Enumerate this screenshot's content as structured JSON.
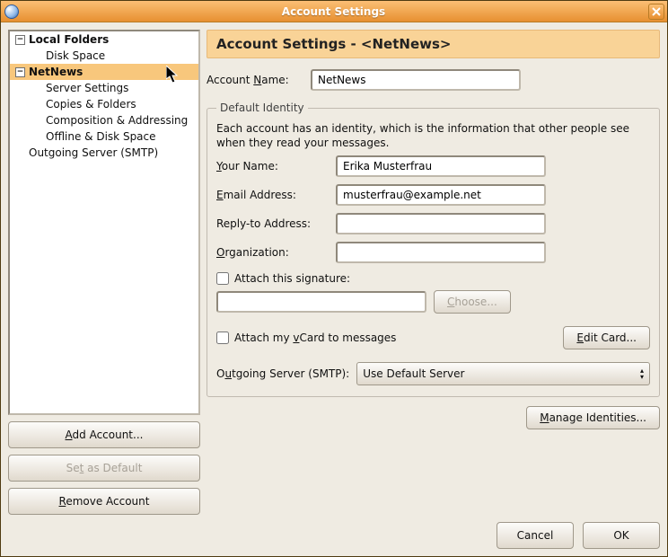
{
  "window": {
    "title": "Account Settings"
  },
  "tree": {
    "items": [
      {
        "label": "Local Folders",
        "level": 0,
        "expandable": true
      },
      {
        "label": "Disk Space",
        "level": 1
      },
      {
        "label": "NetNews",
        "level": 0,
        "expandable": true,
        "selected": true
      },
      {
        "label": "Server Settings",
        "level": 1
      },
      {
        "label": "Copies & Folders",
        "level": 1
      },
      {
        "label": "Composition & Addressing",
        "level": 1
      },
      {
        "label": "Offline & Disk Space",
        "level": 1
      },
      {
        "label": "Outgoing Server (SMTP)",
        "level": 0
      }
    ]
  },
  "buttons": {
    "add_account": {
      "pre": "",
      "u": "A",
      "post": "dd Account..."
    },
    "set_default": {
      "pre": "Se",
      "u": "t",
      "post": " as Default"
    },
    "remove_account": {
      "pre": "",
      "u": "R",
      "post": "emove Account"
    },
    "choose": {
      "pre": "",
      "u": "C",
      "post": "hoose..."
    },
    "edit_card": {
      "pre": "",
      "u": "E",
      "post": "dit Card..."
    },
    "manage_identities": {
      "pre": "",
      "u": "M",
      "post": "anage Identities..."
    },
    "cancel": "Cancel",
    "ok": "OK"
  },
  "header": {
    "title": "Account Settings - <NetNews>"
  },
  "account_name": {
    "label": {
      "pre": "Account ",
      "u": "N",
      "post": "ame:"
    },
    "value": "NetNews"
  },
  "identity": {
    "legend": "Default Identity",
    "desc": "Each account has an identity, which is the information that other people see when they read your messages.",
    "your_name": {
      "label": {
        "pre": "",
        "u": "Y",
        "post": "our Name:"
      },
      "value": "Erika Musterfrau"
    },
    "email": {
      "label": {
        "pre": "",
        "u": "E",
        "post": "mail Address:"
      },
      "value": "musterfrau@example.net"
    },
    "reply_to": {
      "label": "Reply-to Address:",
      "value": ""
    },
    "organization": {
      "label": {
        "pre": "",
        "u": "O",
        "post": "rganization:"
      },
      "value": ""
    },
    "attach_sig": {
      "label": "Attach this signature:",
      "checked": false,
      "path": ""
    },
    "attach_vcard": {
      "label": {
        "pre": "Attach my ",
        "u": "v",
        "post": "Card to messages"
      },
      "checked": false
    },
    "smtp": {
      "label": {
        "pre": "O",
        "u": "u",
        "post": "tgoing Server (SMTP):"
      },
      "value": "Use Default Server"
    }
  }
}
